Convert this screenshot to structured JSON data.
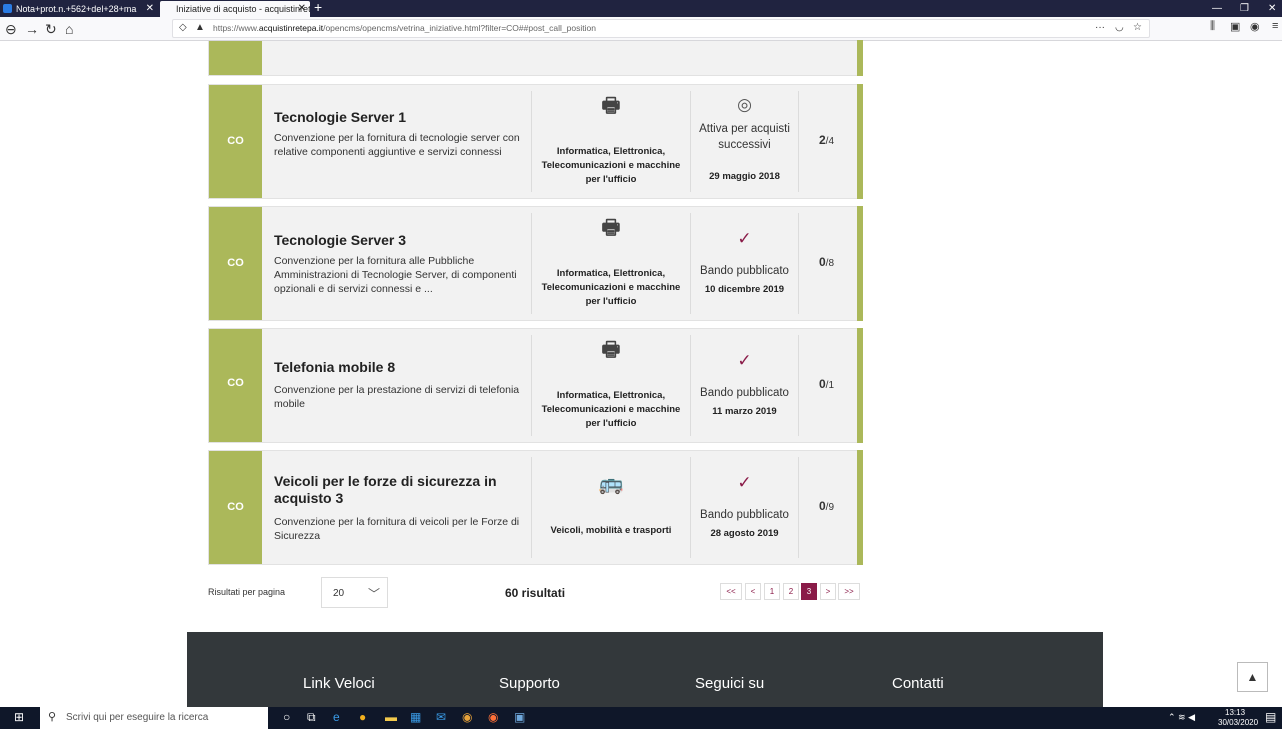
{
  "browser": {
    "tabs": [
      {
        "label": "Nota+prot.n.+562+del+28+ma"
      },
      {
        "label": "Iniziative di acquisto - acquistinrete"
      }
    ],
    "url_prefix": "https://www.",
    "url_domain": "acquistinretepa.it",
    "url_path": "/opencms/opencms/vetrina_iniziative.html?filter=CO##post_call_position"
  },
  "cards": [
    {
      "code": "CO",
      "title": "Tecnologie Server 1",
      "description": "Convenzione per la fornitura di tecnologie server con relative componenti aggiuntive e servizi connessi",
      "category_icon": "printer-icon",
      "category": "Informatica, Elettronica, Telecomunicazioni e macchine per l'ufficio",
      "status_icon": "check-circle-icon",
      "status": "Attiva per acquisti successivi",
      "date": "29 maggio 2018",
      "count": "2",
      "total": "/4"
    },
    {
      "code": "CO",
      "title": "Tecnologie Server 3",
      "description": "Convenzione per la fornitura alle Pubbliche Amministrazioni di Tecnologie Server, di componenti opzionali e di servizi connessi e ...",
      "category_icon": "printer-icon",
      "category": "Informatica, Elettronica, Telecomunicazioni e macchine per l'ufficio",
      "status_icon": "check-icon",
      "status": "Bando pubblicato",
      "date": "10 dicembre 2019",
      "count": "0",
      "total": "/8"
    },
    {
      "code": "CO",
      "title": "Telefonia mobile 8",
      "description": "Convenzione per la prestazione di servizi di telefonia mobile",
      "category_icon": "printer-icon",
      "category": "Informatica, Elettronica, Telecomunicazioni e macchine per l'ufficio",
      "status_icon": "check-icon",
      "status": "Bando pubblicato",
      "date": "11 marzo 2019",
      "count": "0",
      "total": "/1"
    },
    {
      "code": "CO",
      "title": "Veicoli per le forze di sicurezza in acquisto 3",
      "description": "Convenzione per la fornitura di veicoli per le Forze di Sicurezza",
      "category_icon": "vehicles-icon",
      "category": "Veicoli, mobilità e trasporti",
      "status_icon": "check-icon",
      "status": "Bando pubblicato",
      "date": "28 agosto 2019",
      "count": "0",
      "total": "/9"
    }
  ],
  "results": {
    "per_page_label": "Risultati per pagina",
    "per_page_value": "20",
    "total_label": "60 risultati"
  },
  "pagination": [
    "<<",
    "<",
    "1",
    "2",
    "3",
    ">",
    ">>"
  ],
  "pagination_active": "3",
  "footer": {
    "links": [
      "Link Veloci",
      "Supporto",
      "Seguici su",
      "Contatti"
    ]
  },
  "taskbar": {
    "search_placeholder": "Scrivi qui per eseguire la ricerca",
    "time": "13:13",
    "date": "30/03/2020"
  },
  "colors": {
    "accent": "#abb85a",
    "brand": "#8a1b48",
    "footer": "#33383b"
  }
}
